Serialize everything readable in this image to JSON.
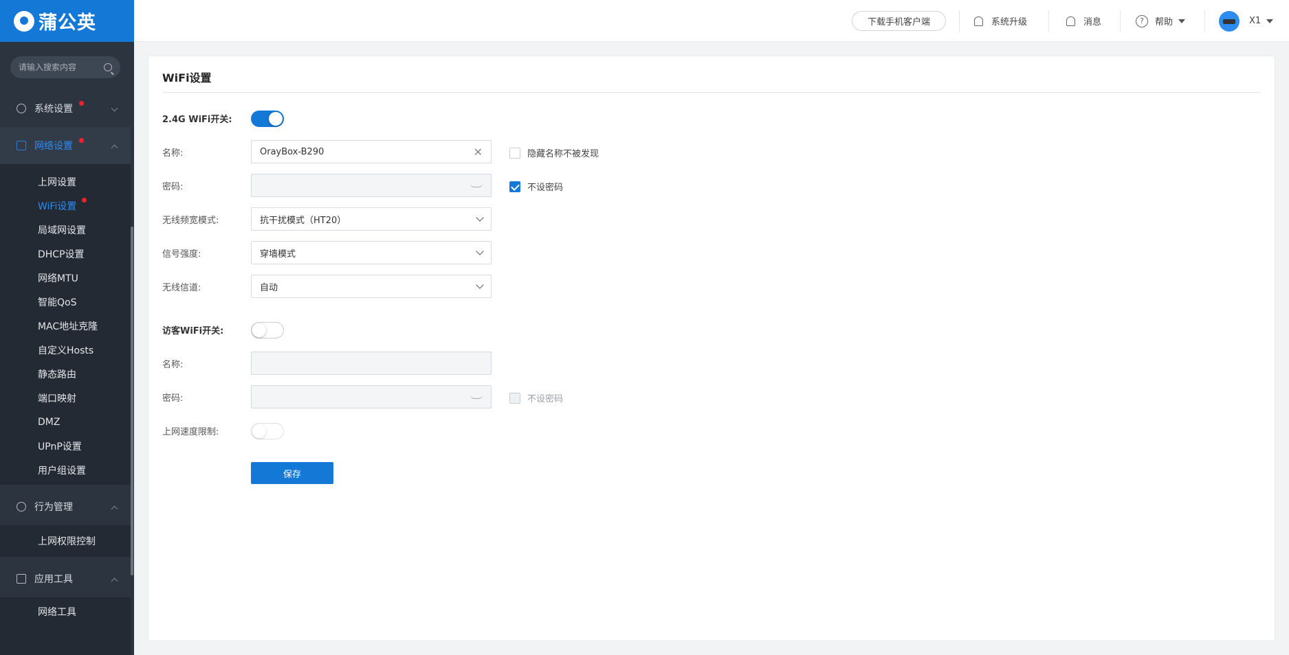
{
  "brand": {
    "name": "蒲公英",
    "primary": "#1478d6",
    "alert": "#f5222d"
  },
  "sidebar": {
    "search_placeholder": "请输入搜索内容",
    "groups": [
      {
        "label": "系统设置"
      },
      {
        "label": "网络设置"
      },
      {
        "label": "行为管理"
      },
      {
        "label": "应用工具"
      }
    ],
    "network_items": [
      "上网设置",
      "WiFi设置",
      "局域网设置",
      "DHCP设置",
      "网络MTU",
      "智能QoS",
      "MAC地址克隆",
      "自定义Hosts",
      "静态路由",
      "端口映射",
      "DMZ",
      "UPnP设置",
      "用户组设置"
    ],
    "behavior_items": [
      "上网权限控制"
    ],
    "tools_items": [
      "网络工具"
    ]
  },
  "header": {
    "download": "下载手机客户端",
    "upgrade": "系统升级",
    "messages": "消息",
    "help": "帮助",
    "user": "X1"
  },
  "wifi": {
    "title": "WiFi设置",
    "wifi24": {
      "label": "2.4G WiFi开关:",
      "enabled": true,
      "name_label": "名称:",
      "name_value": "OrayBox-B290",
      "hide_label": "隐藏名称不被发现",
      "hide_checked": false,
      "password_label": "密码:",
      "password_value": "",
      "nopass_label": "不设密码",
      "nopass_checked": true,
      "bandwidth_label": "无线频宽模式:",
      "bandwidth_value": "抗干扰模式（HT20）",
      "signal_label": "信号强度:",
      "signal_value": "穿墙模式",
      "channel_label": "无线信道:",
      "channel_value": "自动"
    },
    "guest": {
      "label": "访客WiFi开关:",
      "enabled": false,
      "name_label": "名称:",
      "name_value": "",
      "password_label": "密码:",
      "nopass_label": "不设密码",
      "speed_label": "上网速度限制:"
    },
    "save": "保存"
  }
}
